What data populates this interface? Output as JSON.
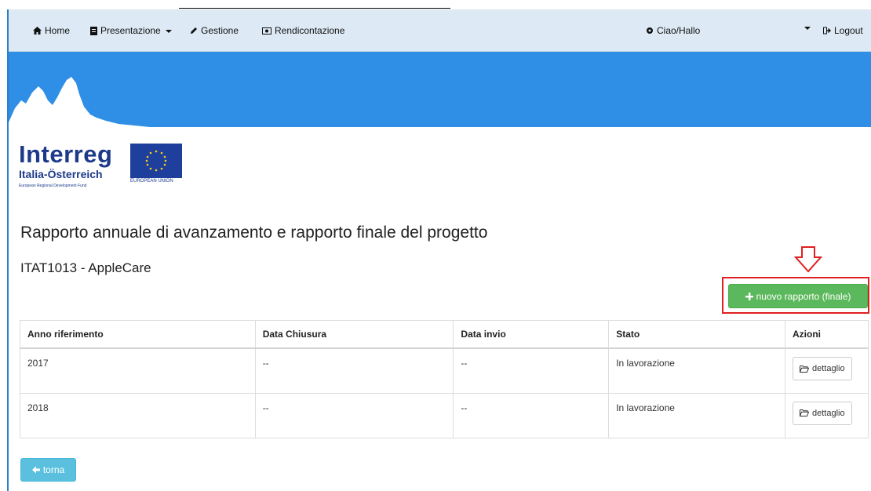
{
  "nav": {
    "home": "Home",
    "presentazione": "Presentazione",
    "gestione": "Gestione",
    "rendicontazione": "Rendicontazione",
    "user": "Ciao/Hallo",
    "logout": "Logout"
  },
  "logo": {
    "name": "Interreg",
    "region": "Italia-Österreich",
    "fund": "European Regional Development Fund",
    "eu": "EUROPEAN UNION"
  },
  "page": {
    "title": "Rapporto annuale di avanzamento e rapporto finale del progetto",
    "project": "ITAT1013 - AppleCare",
    "new_report_button": "nuovo rapporto (finale)",
    "back_button": "torna"
  },
  "table": {
    "headers": [
      "Anno riferimento",
      "Data Chiusura",
      "Data invio",
      "Stato",
      "Azioni"
    ],
    "rows": [
      {
        "anno": "2017",
        "chiusura": "--",
        "invio": "--",
        "stato": "In lavorazione",
        "azione": "dettaglio"
      },
      {
        "anno": "2018",
        "chiusura": "--",
        "invio": "--",
        "stato": "In lavorazione",
        "azione": "dettaglio"
      }
    ]
  },
  "colors": {
    "navbar": "#dde9f4",
    "banner": "#2f8ee5",
    "success": "#5cb85c",
    "info": "#5bc0de",
    "annotation": "#e02020"
  }
}
